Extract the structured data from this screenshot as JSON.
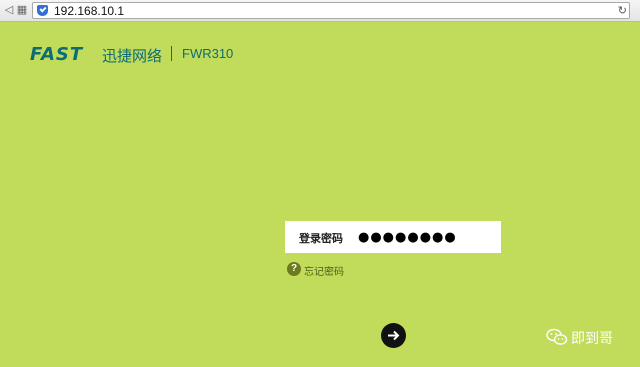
{
  "browser": {
    "url": "192.168.10.1",
    "icons": [
      "back-icon",
      "tabs-icon",
      "security-shield-icon",
      "refresh-icon"
    ]
  },
  "header": {
    "logo": "FAST",
    "brand_cn": "迅捷网络",
    "model": "FWR310"
  },
  "login": {
    "label": "登录密码",
    "password_value": "●●●●●●●●",
    "forgot_label": "忘记密码",
    "submit_icon": "arrow-right-icon"
  },
  "watermark": {
    "text": "即到哥",
    "icon": "wechat-icon"
  },
  "colors": {
    "background": "#c0dc5a",
    "brand": "#0d6c74",
    "button": "#111111"
  }
}
